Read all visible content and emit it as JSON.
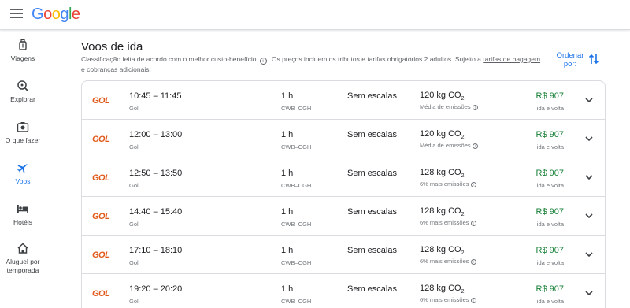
{
  "header": {
    "logo": "Google"
  },
  "sidebar": {
    "items": [
      {
        "label": "Viagens",
        "icon": "luggage-icon"
      },
      {
        "label": "Explorar",
        "icon": "explore-icon"
      },
      {
        "label": "O que fazer",
        "icon": "camera-icon"
      },
      {
        "label": "Voos",
        "icon": "flight-icon",
        "active": true
      },
      {
        "label": "Hotéis",
        "icon": "hotel-icon"
      },
      {
        "label": "Aluguel por temporada",
        "icon": "home-icon"
      }
    ]
  },
  "main": {
    "title": "Voos de ida",
    "desc_a": "Classificação feita de acordo com o melhor custo-benefício",
    "desc_b": "Os preços incluem os tributos e tarifas obrigatórios 2 adultos. Sujeito a",
    "desc_link": "tarifas de bagagem",
    "desc_c": "e cobranças adicionais.",
    "sort_label": "Ordenar por:"
  },
  "flights": [
    {
      "times": "10:45 – 11:45",
      "carrier": "Gol",
      "duration": "1 h",
      "route": "CWB–CGH",
      "stops": "Sem escalas",
      "co2": "120 kg CO",
      "co2_sub": "2",
      "emissions": "Média de emissões",
      "price": "R$ 907",
      "price_type": "ida e volta"
    },
    {
      "times": "12:00 – 13:00",
      "carrier": "Gol",
      "duration": "1 h",
      "route": "CWB–CGH",
      "stops": "Sem escalas",
      "co2": "120 kg CO",
      "co2_sub": "2",
      "emissions": "Média de emissões",
      "price": "R$ 907",
      "price_type": "ida e volta"
    },
    {
      "times": "12:50 – 13:50",
      "carrier": "Gol",
      "duration": "1 h",
      "route": "CWB–CGH",
      "stops": "Sem escalas",
      "co2": "128 kg CO",
      "co2_sub": "2",
      "emissions": "6% mais emissões",
      "price": "R$ 907",
      "price_type": "ida e volta"
    },
    {
      "times": "14:40 – 15:40",
      "carrier": "Gol",
      "duration": "1 h",
      "route": "CWB–CGH",
      "stops": "Sem escalas",
      "co2": "128 kg CO",
      "co2_sub": "2",
      "emissions": "6% mais emissões",
      "price": "R$ 907",
      "price_type": "ida e volta"
    },
    {
      "times": "17:10 – 18:10",
      "carrier": "Gol",
      "duration": "1 h",
      "route": "CWB–CGH",
      "stops": "Sem escalas",
      "co2": "128 kg CO",
      "co2_sub": "2",
      "emissions": "6% mais emissões",
      "price": "R$ 907",
      "price_type": "ida e volta"
    },
    {
      "times": "19:20 – 20:20",
      "carrier": "Gol",
      "duration": "1 h",
      "route": "CWB–CGH",
      "stops": "Sem escalas",
      "co2": "128 kg CO",
      "co2_sub": "2",
      "emissions": "6% mais emissões",
      "price": "R$ 907",
      "price_type": "ida e volta"
    }
  ],
  "airline_logo_text": "GOL",
  "colors": {
    "accent": "#1a73e8",
    "price": "#188038",
    "gol": "#e05a1b"
  }
}
